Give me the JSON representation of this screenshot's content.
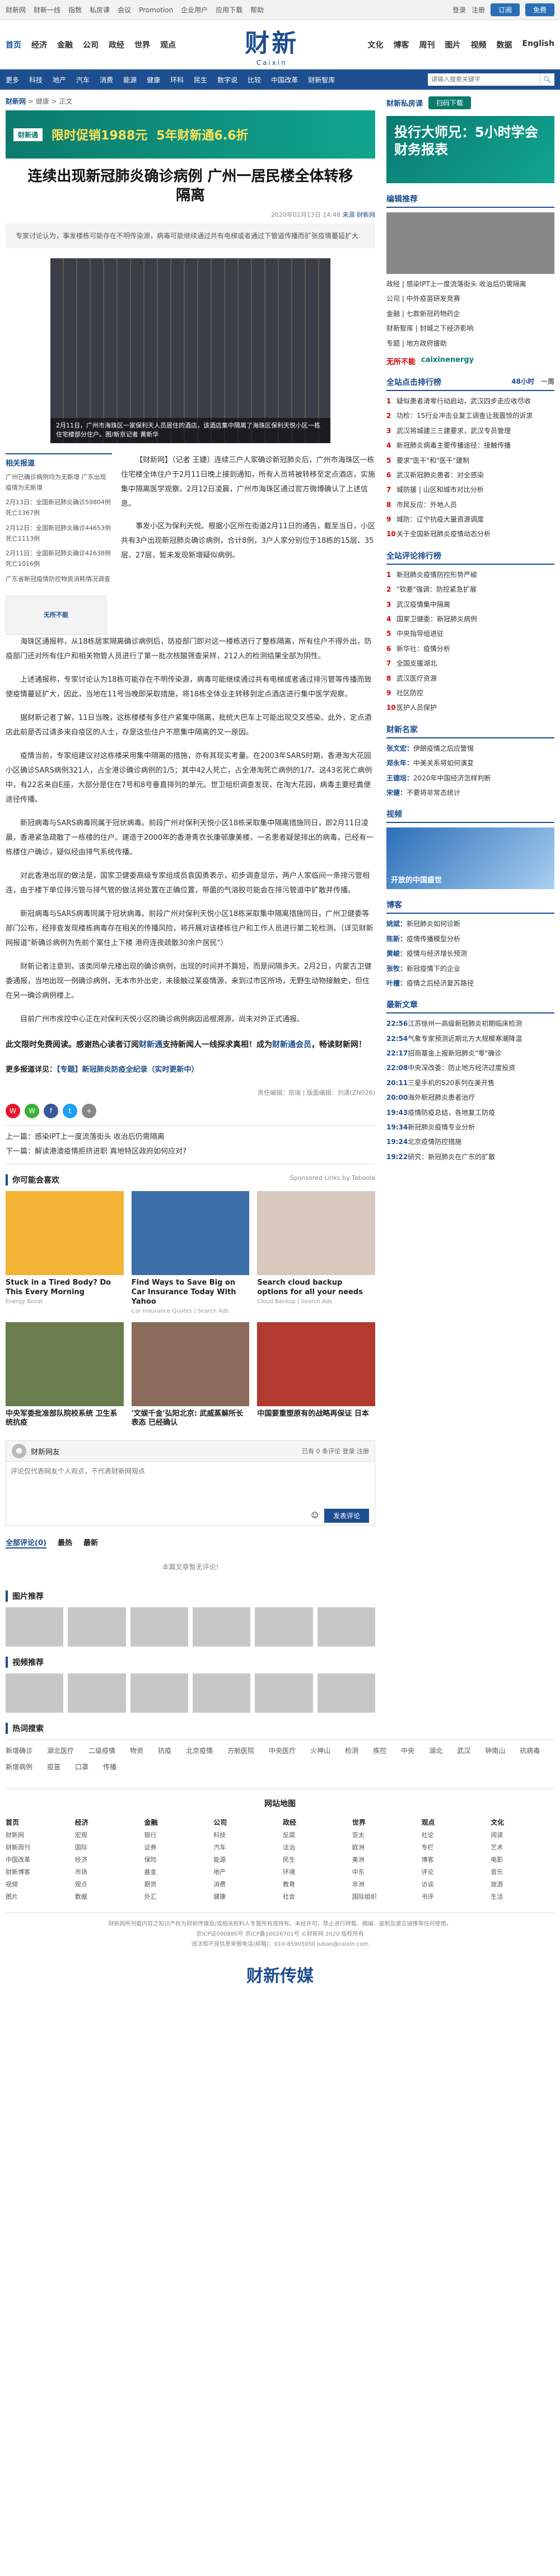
{
  "topbar": {
    "links": [
      "财新网",
      "财新一线",
      "指数",
      "私房课",
      "会议",
      "Promotion",
      "企业用户",
      "应用下载",
      "帮助"
    ],
    "login": "登录",
    "register": "注册",
    "btn1": "订阅",
    "btn2": "免费"
  },
  "header": {
    "left_nav": [
      "首页",
      "经济",
      "金融",
      "公司",
      "政经",
      "世界",
      "观点"
    ],
    "logo_cn": "财新",
    "logo_en": "Caixin",
    "right_nav": [
      "文化",
      "博客",
      "周刊",
      "图片",
      "视频",
      "数据",
      "English"
    ]
  },
  "subnav": {
    "items": [
      "更多",
      "科技",
      "地产",
      "汽车",
      "消费",
      "能源",
      "健康",
      "环科",
      "民生",
      "数字说",
      "比较",
      "中国改革",
      "财新智库"
    ],
    "search_placeholder": "请输入搜索关键字"
  },
  "article": {
    "breadcrumb_site": "财新网",
    "breadcrumb_rest": " > 健康 > 正文",
    "ad_tag": "财新通",
    "ad_text": "限时促销1988元",
    "ad_big": "5年财新通6.6折",
    "title": "连续出现新冠肺炎确诊病例 广州一居民楼全体转移隔离",
    "meta_time": "2020年02月13日 14:48",
    "meta_source": "来源 财新网",
    "summary": "专家讨论认为，事发楼栋可能存在不明传染源，病毒可能继续通过共有电梯或者通过下管道传播而扩张疫情蔓延扩大",
    "photo_caption": "2月11日，广州市海珠区一家保利天人员居住的酒店，该酒店集中隔离了海珠区保利天悦小区一栋住宅楼部分住户。图/新京记者 黄新华",
    "related_title": "相关报道",
    "related": [
      "广州已确诊病例均为无新增 广东出现疫情为无新增",
      "2月13日：全国新冠肺炎确诊59804例 死亡1367例",
      "2月12日：全国新冠肺炎确诊44653例 死亡1113例",
      "2月11日：全国新冠肺炎确诊42638例 死亡1016例",
      "广东省新冠疫情防控物资消耗情况调查"
    ],
    "related_ad": "无所不能",
    "lead": "【财新网】（记者 王婕）连续三户人家确诊新冠肺炎后，广州市海珠区一栋住宅楼全体住户于2月11日晚上接到通知，所有人员将被转移至定点酒店，实施集中隔离医学观察。2月12日凌晨，广州市海珠区通过官方微博确认了上述信息。",
    "para2": "事发小区为保利天悦。根据小区所在街道2月11日的通告，截至当日，小区共有3户出现新冠肺炎确诊病例，合计8例，3户人家分别位于18栋的15层、35层、27层，暂未发现新增疑似病例。",
    "paragraphs": [
      "海珠区通报称，从18栋居家隔离确诊病例后，防疫部门即对这一楼栋进行了整栋隔离，所有住户不得外出，防疫部门还对所有住户和相关物管人员进行了第一批次核酸筛查采样，212人的检测结果全部为阴性。",
      "上述通报称，专家讨论认为18栋可能存在不明传染源，病毒可能继续通过共有电梯或者通过排污管等传播而致使疫情蔓延扩大，因此，当地在11号当晚即采取措施，将18栋全体业主转移到定点酒店进行集中医学观察。",
      "据财新记者了解，11日当晚，这栋楼楼有多住户紧集中隔离，批统大巴车上可能出现交叉感染。此外，定点酒店此前是否过请多来自疫区的人士，存是这些住户不愿集中隔离的又一原因。",
      "疫情当前，专家组建议对这栋楼采用集中隔离的措施，亦有其现实考量。在2003年SARS时期，香港淘大花园小区确诊SARS病例321人，占全港诊确诊病例的1/5；其中42人死亡，占全港淘死亡病例的1/7。这43名死亡病例中，有22名来自E座，大部分是住在7号和8号垂直排列的单元。世卫组织调查发现，在淘大花园，病毒主要经粪便途径传播。",
      "新冠病毒与SARS病毒同属于冠状病毒。前段广州对保利天悦小区18栋采取集中隔离措施同日，即2月11日凌晨，香港紧急疏散了一栋楼的住户。建造于2000年的香港青衣长康邨康美楼，一名患者疑是排出的病毒，已经有一栋楼住户确诊，疑似经由排气系统传播。",
      "对此香港出现的做法是，国家卫健委高级专家组成员袁国勇表示，初步调查显示，两户人家临间一条排污管相连，由于楼下单位排污管与排气管的做法将处置在正确位置，带菌的气溶胶可能会在排污管道中扩散并传播。",
      "新冠病毒与SARS病毒同属于冠状病毒。前段广州对保利天悦小区18栋采取集中隔离措施同日，广州卫健委等部门公布，经排查发现楼栋病毒存在相关的传播风险，将开展对该楼栋住户和工作人员进行第二轮检测。（详见财新网报道\"新确诊病例为先前个案住上下楼 港府连夜疏散30余户居民\"）",
      "财新记者注意到，该类同单元楼出现的确诊病例，出现的时间并不算短，而是间隔多天。2月2日，内蒙古卫健委通报，当地出现一例确诊病例，无本市外出史，未接触过某疫情源，来到过市区所场，无野生动物接触史，但住在另一确诊病例楼上。",
      "目前广州市疾控中心正在对保利天悦小区的确诊病例病因追根溯源，尚未对外正式通报。"
    ],
    "notice_a": "此文限时免费阅读。感谢热心读者订阅",
    "notice_link1": "财新通",
    "notice_b": "支持新闻人一线探求真相！成为",
    "notice_link2": "财新通会员",
    "notice_c": "，畅读财新网！",
    "more_label": "更多报道详见：",
    "more_link": "【专题】新冠肺炎防疫全纪录（实时更新中）",
    "editor": "责任编辑：",
    "editor_name": "凯瑞 | 版面编辑：刘潇(ZN026)",
    "prev": "上一篇：感染IPT上一度流落街头 收治后仍需隔离",
    "next": "下一篇：解读港澳疫情拒挤进职 真地特区政府如何应对?"
  },
  "recommend": {
    "title": "你可能会喜欢",
    "sponsor": "Sponsored Links by Taboola",
    "cards": [
      {
        "t": "Stuck in a Tired Body? Do This Every Morning",
        "s": "Energy Boost"
      },
      {
        "t": "Find Ways to Save Big on Car Insurance Today With Yahoo",
        "s": "Car Insurance Quotes | Search Ads"
      },
      {
        "t": "Search cloud backup options for all your needs",
        "s": "Cloud Backup | Search Ads"
      },
      {
        "t": "中央军委批准部队院校系统 卫生系统抗疫",
        "s": ""
      },
      {
        "t": "'文娱千金'弘阳北京: 武威蒸解所长表态 已经确认",
        "s": ""
      },
      {
        "t": "中国要重塑原有的战略再保证 日本",
        "s": ""
      }
    ]
  },
  "comment": {
    "title": "财新网友",
    "count": "已有 0 条评论 登录 注册",
    "placeholder": "评论仅代表网友个人观点，不代表财新网观点",
    "submit": "发表评论",
    "tab_all": "全部评论(0)",
    "tab_hot": "最热",
    "tab_new": "最新",
    "empty": "本篇文章暂无评论!"
  },
  "sections": {
    "pics": "图片推荐",
    "videos": "视频推荐",
    "hot": "热词搜索",
    "hotwords": [
      "新增确诊",
      "湖北医疗",
      "二级疫情",
      "物资",
      "抗疫",
      "北京疫情",
      "方舱医院",
      "中央医疗",
      "火神山",
      "检测",
      "疾控",
      "中央",
      "湖北",
      "武汉",
      "钟南山",
      "抗病毒",
      "新增病例",
      "疫苗",
      "口罩",
      "传播"
    ],
    "sitemap": "网站地图",
    "sitemap_cols": [
      {
        "h": "首页",
        "items": [
          "财新网",
          "财新周刊",
          "中国改革",
          "财新博客",
          "视频",
          "图片"
        ]
      },
      {
        "h": "经济",
        "items": [
          "宏观",
          "国际",
          "经济",
          "市场",
          "观点",
          "数据"
        ]
      },
      {
        "h": "金融",
        "items": [
          "银行",
          "证券",
          "保险",
          "基金",
          "期货",
          "外汇"
        ]
      },
      {
        "h": "公司",
        "items": [
          "科技",
          "汽车",
          "能源",
          "地产",
          "消费",
          "健康"
        ]
      },
      {
        "h": "政经",
        "items": [
          "反腐",
          "法治",
          "民生",
          "环境",
          "教育",
          "社会"
        ]
      },
      {
        "h": "世界",
        "items": [
          "亚太",
          "欧洲",
          "美洲",
          "中东",
          "非洲",
          "国际组织"
        ]
      },
      {
        "h": "观点",
        "items": [
          "社论",
          "专栏",
          "博客",
          "评论",
          "访谈",
          "书评"
        ]
      },
      {
        "h": "文化",
        "items": [
          "阅读",
          "艺术",
          "电影",
          "音乐",
          "旅游",
          "生活"
        ]
      }
    ],
    "footer1": "财新网所刊载内容之知识产权为财新传媒及/或相关权利人专属所有或持有。未经许可，禁止进行转载、摘编、复制及建立镜像等任何使用。",
    "footer2": "京ICP证090880号 京ICP备10026701号 ©财新网 2020 版权所有",
    "footer3": "违法和不良信息举报电话(邮箱)：010-85905050 jubao@caixin.com",
    "bottom_logo": "财新传媒"
  },
  "side": {
    "app_title": "财新私房课",
    "app_btn": "扫码下载",
    "ad_big": "投行大师兄：5小时学会财务报表",
    "editor_title": "编辑推荐",
    "editor_items": [
      "政经 | 感染IPT上一度流落街头 收治后仍需隔离",
      "公司 | 中外疫苗研发竞赛",
      "金融 | 七款新冠药物药企",
      "财新智库 | 封城之下经济影响",
      "专题 | 地方政府援助"
    ],
    "partner1": "无所不能",
    "partner2": "caixinenergy",
    "hot_title": "全站点击排行榜",
    "hot_tab1": "48小时",
    "hot_tab2": "一周",
    "hot_items": [
      "疑似患者清零行动启动，武汉四步走应收尽收",
      "功检：15行业冲击业复工调查让我震惊的诉求",
      "武汉将城建三三建要求，武汉专员管理",
      "新冠肺炎病毒主要传播途径：接触传播",
      "要求\"医干\"和\"医干\"建制",
      "武汉新冠肺炎患者：对全感染",
      "城防援 | 山区和城市对比分析",
      "市民反应：外地人员",
      "城防：辽宁抗疫大量资源调度",
      "关于全国新冠肺炎疫情动态分析"
    ],
    "comment_title": "全站评论排行榜",
    "comment_items": [
      "新冠肺炎疫情防控形势严峻",
      "\"钦差\"强调：防控紧急扩展",
      "武汉疫情集中隔离",
      "国家卫健委：新冠肺炎病例",
      "中央指导组进驻",
      "新华社：疫情分析",
      "全国支援湖北",
      "武汉医疗资源",
      "社区防控",
      "医护人员保护"
    ],
    "people_title": "财新名家",
    "people": [
      {
        "n": "张文宏：",
        "t": "伊朗疫情之后应警惕"
      },
      {
        "n": "郑永年：",
        "t": "中美关系将如何演变"
      },
      {
        "n": "王德培：",
        "t": "2020年中国经济怎样判断"
      },
      {
        "n": "宋健：",
        "t": "不要将非常态统计"
      }
    ],
    "video_title": "视频",
    "video_caption": "开放的中国盛世",
    "blog_title": "博客",
    "blog": [
      {
        "n": "姚斌：",
        "t": "新冠肺炎如何诊断"
      },
      {
        "n": "陈新：",
        "t": "疫情传播模型分析"
      },
      {
        "n": "黄峻：",
        "t": "疫情与经济增长预测"
      },
      {
        "n": "张牧：",
        "t": "新冠疫情下的企业"
      },
      {
        "n": "叶檀：",
        "t": "疫情之后经济复苏路径"
      }
    ],
    "latest_title": "最新文章",
    "latest": [
      {
        "tm": "22:56",
        "t": "江苏徐州一高级新冠肺炎初期临床检测"
      },
      {
        "tm": "22:54",
        "t": "气象专家预测近期北方大规模寒潮降温"
      },
      {
        "tm": "22:17",
        "t": "招商基金上报新冠肺炎\"零\"确诊"
      },
      {
        "tm": "22:08",
        "t": "中央深改委：防止地方经济过度投资"
      },
      {
        "tm": "20:11",
        "t": "三星手机的S20系列在美开售"
      },
      {
        "tm": "20:00",
        "t": "海外新冠肺炎患者治疗"
      },
      {
        "tm": "19:43",
        "t": "疫情防疫总结，各地复工防疫"
      },
      {
        "tm": "19:34",
        "t": "新冠肺炎疫情专业分析"
      },
      {
        "tm": "19:24",
        "t": "北京疫情防控措施"
      },
      {
        "tm": "19:22",
        "t": "研究：新冠肺炎在广东的扩散"
      }
    ]
  }
}
